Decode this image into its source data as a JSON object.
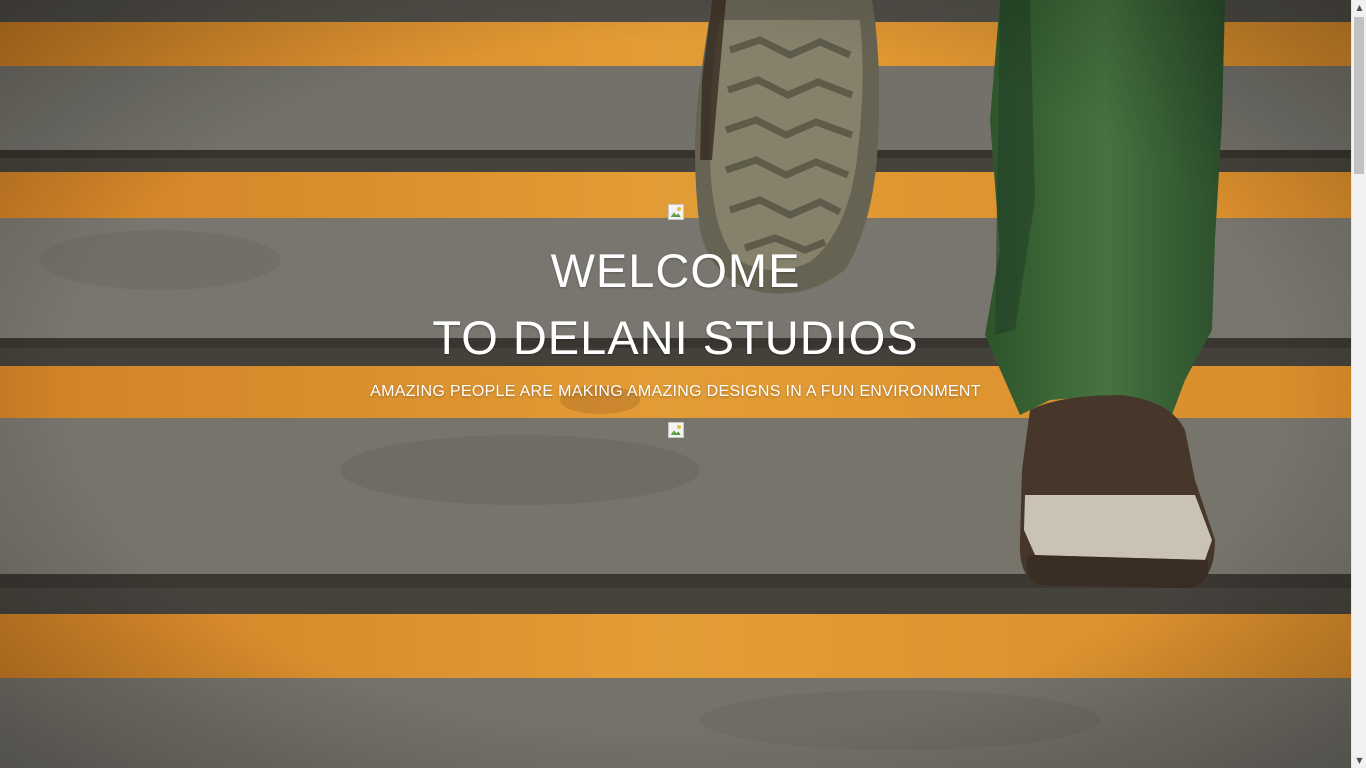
{
  "hero": {
    "title_line1": "WELCOME",
    "title_line2": "TO DELANI STUDIOS",
    "subtitle": "AMAZING PEOPLE ARE MAKING AMAZING DESIGNS IN A FUN ENVIRONMENT",
    "top_image_icon": "broken-image-icon",
    "bottom_image_icon": "broken-image-icon"
  },
  "background": {
    "description_icon": "stairs-photo",
    "stripe_color": "#f0a030",
    "step_color": "#7a7872",
    "edge_color": "#3e3a36",
    "pants_color": "#3f6a3a",
    "shoe_color": "#4a3a2c"
  },
  "scrollbar": {
    "up_icon": "scroll-up-arrow-icon",
    "down_icon": "scroll-down-arrow-icon"
  }
}
